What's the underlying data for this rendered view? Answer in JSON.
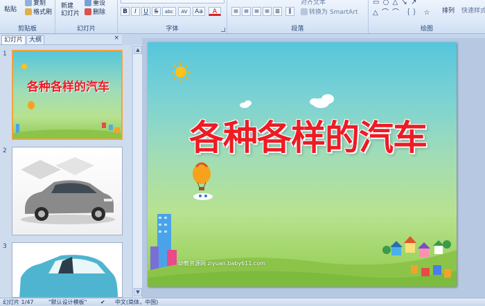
{
  "ribbon": {
    "clipboard": {
      "label": "剪贴板",
      "paste": "粘贴",
      "copy": "复制",
      "format_painter": "格式刷"
    },
    "slides": {
      "label": "幻灯片",
      "new_slide": "新建\n幻灯片",
      "reset": "重设",
      "delete": "删除"
    },
    "font": {
      "label": "字体",
      "bold": "B",
      "italic": "I",
      "underline": "U",
      "strike": "S",
      "shadow": "abc",
      "spacing": "AV",
      "case": "Aa",
      "color": "A"
    },
    "paragraph": {
      "label": "段落",
      "align_text": "对齐文本",
      "convert_smartart": "转换为 SmartArt"
    },
    "drawing": {
      "label": "绘图",
      "arrange": "排列",
      "quick_styles": "快速样式"
    }
  },
  "outline_tabs": {
    "slides": "幻灯片",
    "outline": "大纲"
  },
  "thumbnails": [
    {
      "number": "1",
      "title": "各种各样的汽车"
    },
    {
      "number": "2"
    },
    {
      "number": "3"
    }
  ],
  "slide": {
    "title": "各种各样的汽车",
    "footer": "幼教资源网 ziyuan.baby611.com",
    "title_color": "#ee1b24"
  },
  "status_bar": {
    "slide_pos": "幻灯片 1/47",
    "theme": "\"默认设计模板\"",
    "language": "中文(简体，中国)"
  }
}
